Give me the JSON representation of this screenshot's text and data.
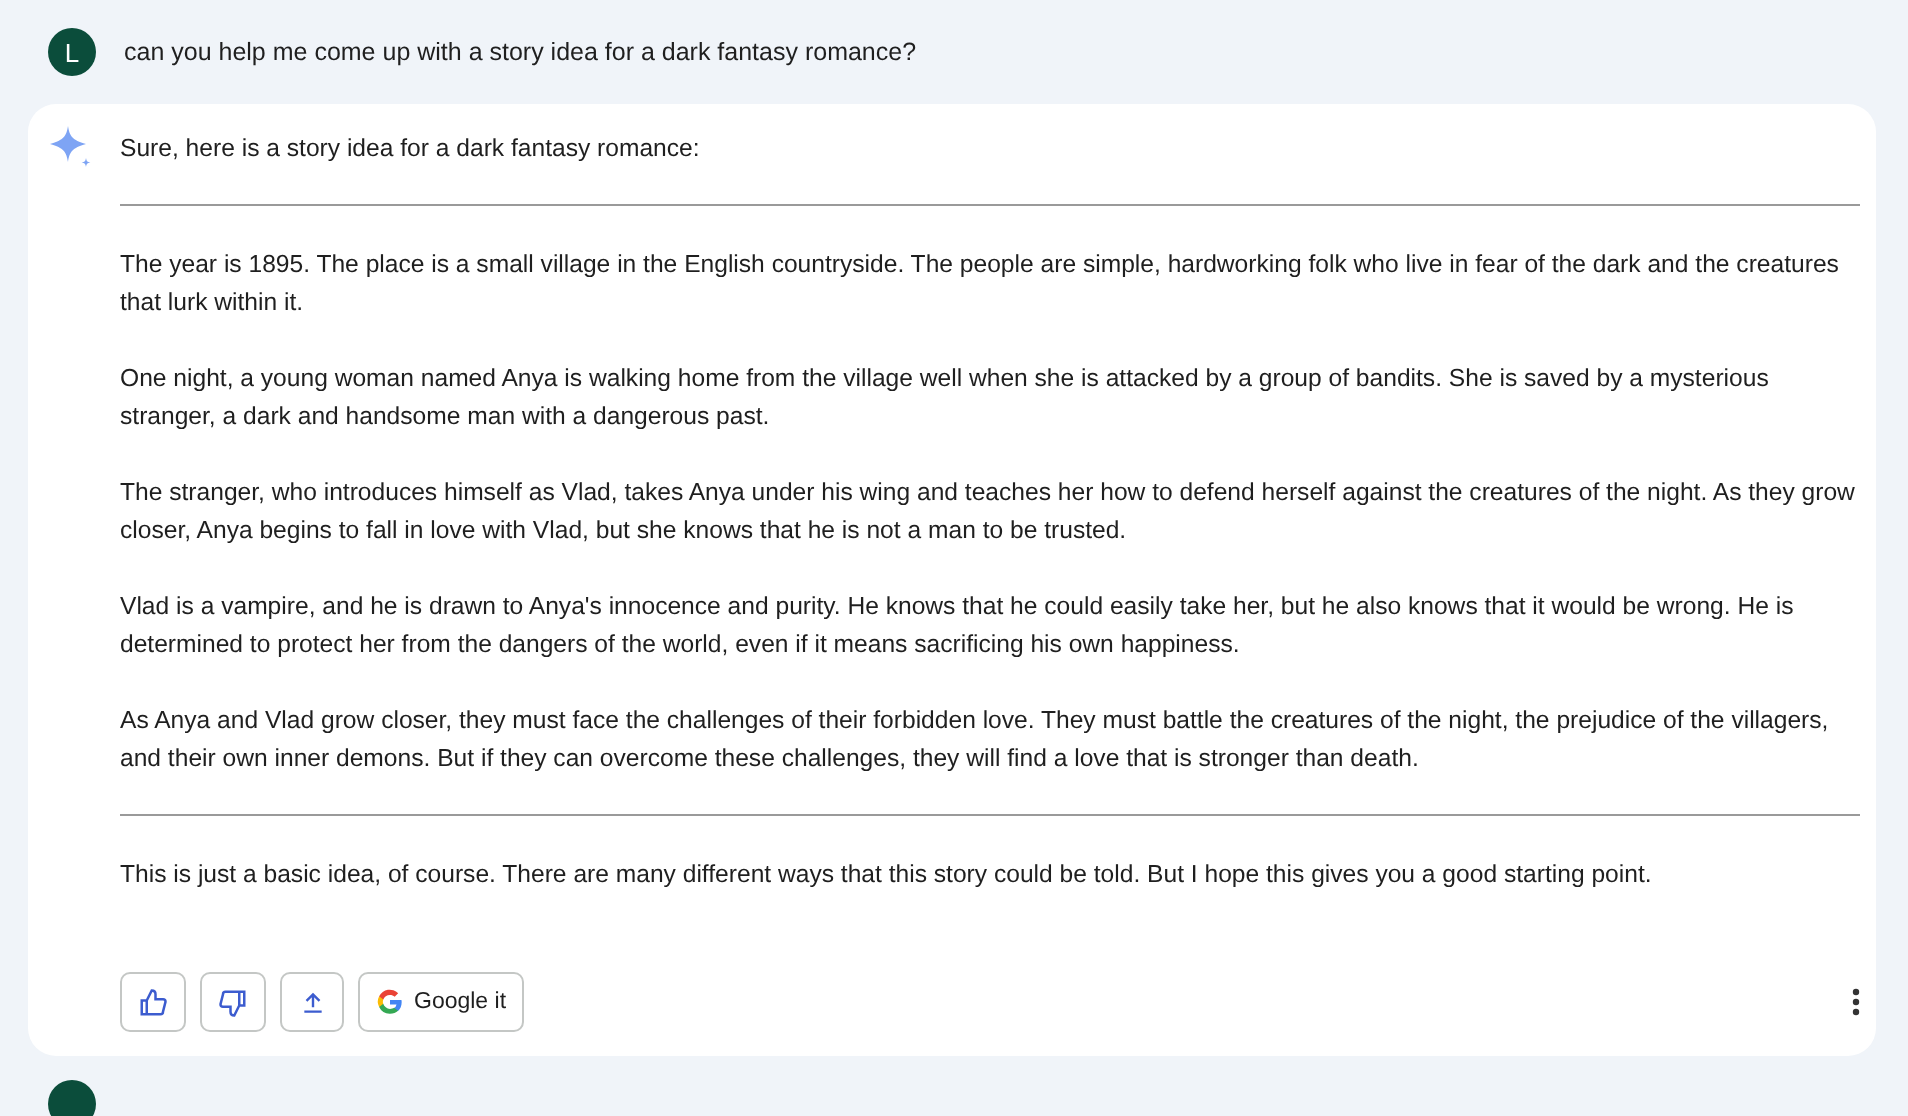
{
  "user_message": {
    "avatar_letter": "L",
    "text": "can you help me come up with a story idea for a dark fantasy romance?"
  },
  "response": {
    "intro": "Sure, here is a story idea for a dark fantasy romance:",
    "story": [
      "The year is 1895. The place is a small village in the English countryside. The people are simple, hardworking folk who live in fear of the dark and the creatures that lurk within it.",
      "One night, a young woman named Anya is walking home from the village well when she is attacked by a group of bandits. She is saved by a mysterious stranger, a dark and handsome man with a dangerous past.",
      "The stranger, who introduces himself as Vlad, takes Anya under his wing and teaches her how to defend herself against the creatures of the night. As they grow closer, Anya begins to fall in love with Vlad, but she knows that he is not a man to be trusted.",
      "Vlad is a vampire, and he is drawn to Anya's innocence and purity. He knows that he could easily take her, but he also knows that it would be wrong. He is determined to protect her from the dangers of the world, even if it means sacrificing his own happiness.",
      "As Anya and Vlad grow closer, they must face the challenges of their forbidden love. They must battle the creatures of the night, the prejudice of the villagers, and their own inner demons. But if they can overcome these challenges, they will find a love that is stronger than death."
    ],
    "outro": "This is just a basic idea, of course. There are many different ways that this story could be told. But I hope this gives you a good starting point.",
    "actions": [
      {
        "kind": "like"
      },
      {
        "kind": "dislike"
      },
      {
        "kind": "share"
      },
      {
        "kind": "google",
        "label": "Google it"
      }
    ]
  }
}
